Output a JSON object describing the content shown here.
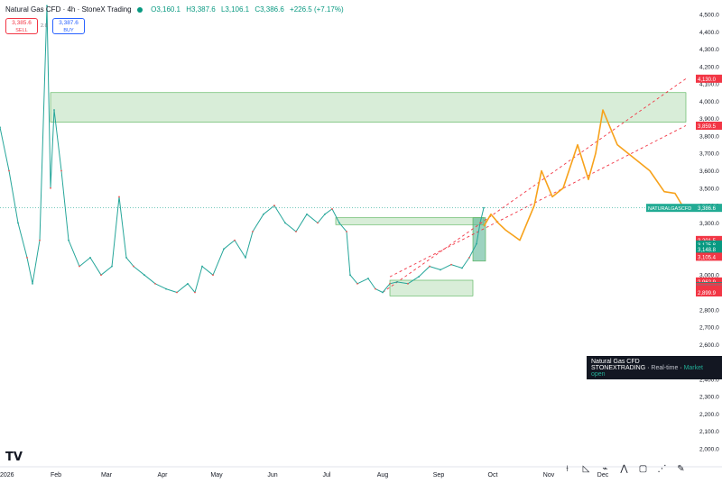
{
  "header": {
    "symbol": "Natural Gas CFD · 4h · StoneX Trading",
    "open": "O3,160.1",
    "high": "H3,387.6",
    "low": "L3,106.1",
    "close": "C3,386.6",
    "change": "+226.5 (+7.17%)"
  },
  "trade_buttons": {
    "sell_price": "3,385.6",
    "sell_label": "SELL",
    "buy_price": "3,387.6",
    "buy_label": "BUY",
    "spread": "2.0"
  },
  "info_box": {
    "name": "Natural Gas CFD",
    "source": "STONEXTRADING",
    "mode": "Real-time",
    "status": "Market open"
  },
  "logo_text": "TV",
  "toolbar_icons": [
    "ruler-icon",
    "trend-line-icon",
    "path-icon",
    "pattern-icon",
    "rectangle-icon",
    "fib-icon",
    "brush-icon"
  ],
  "chart_data": {
    "type": "line",
    "ylim": [
      2000,
      4600
    ],
    "y_ticks": [
      "4,500.0",
      "4,400.0",
      "4,300.0",
      "4,200.0",
      "4,100.0",
      "4,000.0",
      "3,900.0",
      "3,800.0",
      "3,700.0",
      "3,600.0",
      "3,500.0",
      "3,400.0",
      "3,300.0",
      "3,200.0",
      "3,100.0",
      "3,000.0",
      "2,900.0",
      "2,800.0",
      "2,700.0",
      "2,600.0",
      "2,500.0",
      "2,400.0",
      "2,300.0",
      "2,200.0",
      "2,100.0",
      "2,000.0"
    ],
    "x_labels": [
      "2026",
      "Feb",
      "Mar",
      "Apr",
      "May",
      "Jun",
      "Jul",
      "Aug",
      "Sep",
      "Oct",
      "Nov",
      "Dec"
    ],
    "x_label_days": [
      0,
      31,
      59,
      90,
      120,
      151,
      181,
      212,
      243,
      273,
      304,
      334
    ],
    "series": [
      {
        "name": "Natural Gas CFD",
        "color": "#26a69a",
        "points": [
          [
            0,
            3850
          ],
          [
            5,
            3600
          ],
          [
            10,
            3300
          ],
          [
            15,
            3100
          ],
          [
            18,
            2950
          ],
          [
            22,
            3200
          ],
          [
            26,
            4550
          ],
          [
            28,
            3500
          ],
          [
            30,
            3950
          ],
          [
            34,
            3600
          ],
          [
            38,
            3200
          ],
          [
            44,
            3050
          ],
          [
            50,
            3100
          ],
          [
            56,
            3000
          ],
          [
            62,
            3050
          ],
          [
            66,
            3450
          ],
          [
            70,
            3100
          ],
          [
            74,
            3050
          ],
          [
            80,
            3000
          ],
          [
            86,
            2950
          ],
          [
            92,
            2920
          ],
          [
            98,
            2900
          ],
          [
            104,
            2950
          ],
          [
            108,
            2900
          ],
          [
            112,
            3050
          ],
          [
            118,
            3000
          ],
          [
            124,
            3150
          ],
          [
            130,
            3200
          ],
          [
            136,
            3100
          ],
          [
            140,
            3250
          ],
          [
            146,
            3350
          ],
          [
            152,
            3400
          ],
          [
            158,
            3300
          ],
          [
            164,
            3250
          ],
          [
            170,
            3350
          ],
          [
            176,
            3300
          ],
          [
            180,
            3350
          ],
          [
            184,
            3380
          ],
          [
            188,
            3300
          ],
          [
            192,
            3250
          ],
          [
            194,
            3000
          ],
          [
            198,
            2950
          ],
          [
            204,
            2980
          ],
          [
            208,
            2920
          ],
          [
            212,
            2900
          ],
          [
            216,
            2950
          ],
          [
            220,
            2960
          ],
          [
            226,
            2950
          ],
          [
            232,
            2990
          ],
          [
            238,
            3050
          ],
          [
            244,
            3030
          ],
          [
            250,
            3060
          ],
          [
            256,
            3040
          ],
          [
            260,
            3100
          ],
          [
            264,
            3180
          ],
          [
            266,
            3300
          ],
          [
            268,
            3386.6
          ]
        ],
        "last_value": "3,386.6"
      },
      {
        "name": "projection",
        "color": "#f7a21b",
        "points": [
          [
            268,
            3280
          ],
          [
            272,
            3350
          ],
          [
            276,
            3300
          ],
          [
            280,
            3260
          ],
          [
            288,
            3200
          ],
          [
            296,
            3400
          ],
          [
            300,
            3600
          ],
          [
            306,
            3450
          ],
          [
            312,
            3500
          ],
          [
            320,
            3750
          ],
          [
            326,
            3550
          ],
          [
            330,
            3700
          ],
          [
            334,
            3950
          ],
          [
            338,
            3850
          ],
          [
            342,
            3750
          ],
          [
            348,
            3700
          ],
          [
            354,
            3650
          ],
          [
            360,
            3600
          ],
          [
            368,
            3480
          ],
          [
            374,
            3470
          ],
          [
            378,
            3400
          ]
        ]
      }
    ],
    "channel_lines": [
      {
        "from": [
          212,
          2900
        ],
        "to": [
          380,
          4130
        ],
        "color": "#f23645"
      },
      {
        "from": [
          216,
          2990
        ],
        "to": [
          380,
          3860
        ],
        "color": "#f23645"
      }
    ],
    "zones": [
      {
        "x0": 28,
        "x1": 380,
        "y0": 3880,
        "y1": 4050,
        "color": "#b8dfb8"
      },
      {
        "x0": 186,
        "x1": 268,
        "y0": 3290,
        "y1": 3330,
        "color": "#b8dfb8"
      },
      {
        "x0": 216,
        "x1": 262,
        "y0": 2880,
        "y1": 2970,
        "color": "#b8dfb8"
      },
      {
        "x0": 262,
        "x1": 269,
        "y0": 3080,
        "y1": 3330,
        "color": "#4caf8d"
      }
    ],
    "price_labels": [
      {
        "text": "4,130.0",
        "value": 4130,
        "color": "#f23645"
      },
      {
        "text": "3,859.5",
        "value": 3859.5,
        "color": "#f23645"
      },
      {
        "text": "3,386.6",
        "value": 3386.6,
        "color": "#22ab94",
        "tag": "NATURALGASCFD"
      },
      {
        "text": "3,201.5",
        "value": 3201.5,
        "color": "#f23645"
      },
      {
        "text": "3,175.8",
        "value": 3175.8,
        "color": "#089981"
      },
      {
        "text": "3,148.8",
        "value": 3148.8,
        "color": "#089981"
      },
      {
        "text": "3,105.4",
        "value": 3105.4,
        "color": "#f23645"
      },
      {
        "text": "2,962.9",
        "value": 2962.9,
        "color": "#f23645"
      },
      {
        "text": "2,936.2",
        "value": 2936.2,
        "color": "#f23645"
      },
      {
        "text": "2,934.9",
        "value": 2934.9,
        "color": "#089981"
      },
      {
        "text": "2,931.1",
        "value": 2931.1,
        "color": "#f23645"
      },
      {
        "text": "2,922.7",
        "value": 2922.7,
        "color": "#787b86"
      },
      {
        "text": "2,918.3",
        "value": 2918.3,
        "color": "#f23645"
      },
      {
        "text": "2,906.7",
        "value": 2906.7,
        "color": "#f23645"
      },
      {
        "text": "2,904.2",
        "value": 2904.2,
        "color": "#f23645"
      },
      {
        "text": "2,899.9",
        "value": 2899.9,
        "color": "#f23645"
      }
    ]
  }
}
